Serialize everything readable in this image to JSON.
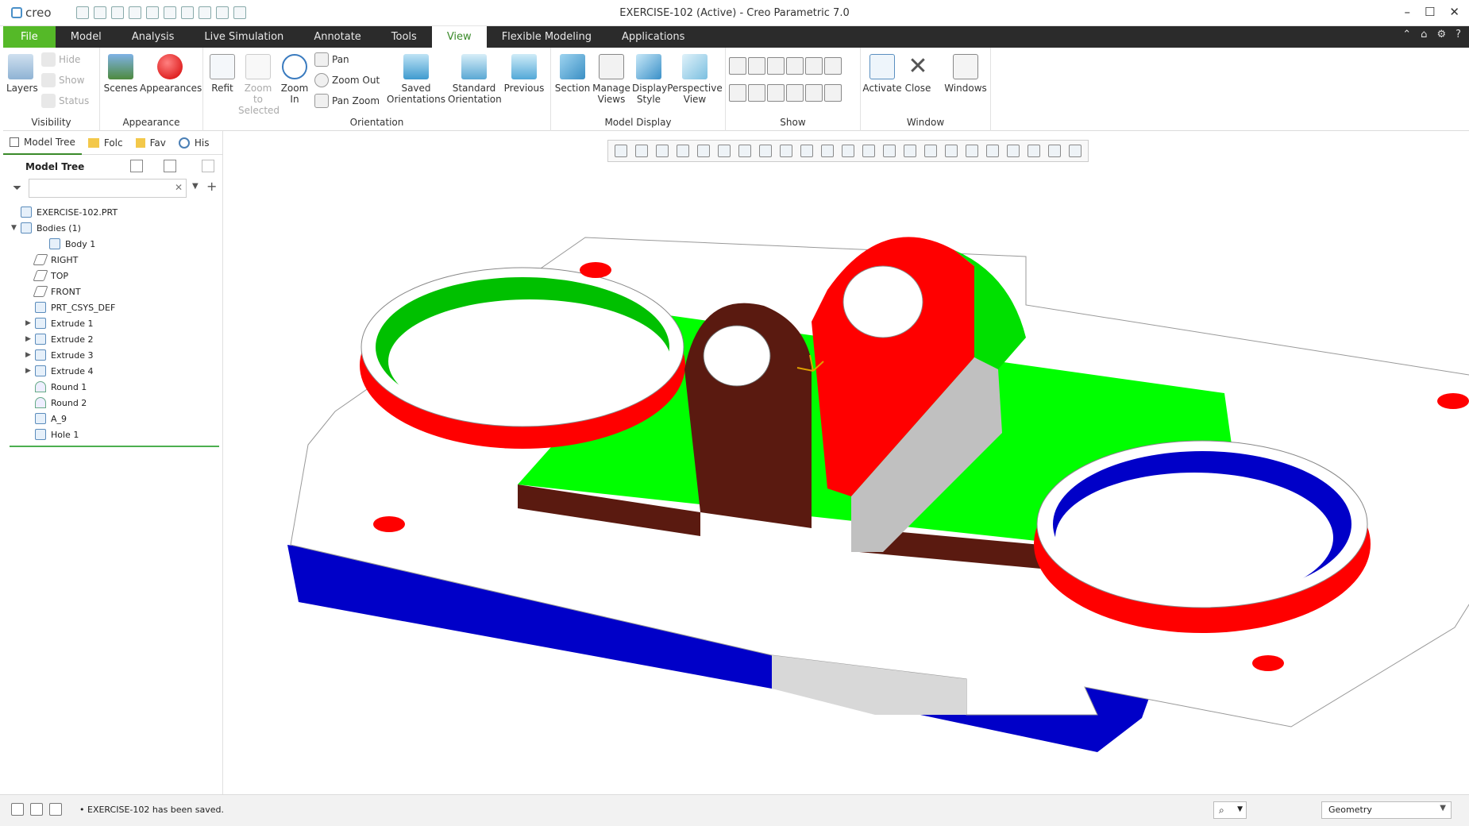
{
  "app": {
    "logo_text": "creo",
    "window_title": "EXERCISE-102 (Active) - Creo Parametric 7.0"
  },
  "ribbon_tabs": [
    "File",
    "Model",
    "Analysis",
    "Live Simulation",
    "Annotate",
    "Tools",
    "View",
    "Flexible Modeling",
    "Applications"
  ],
  "active_tab": "View",
  "ribbon": {
    "visibility": {
      "label": "Visibility",
      "layers": "Layers",
      "hide": "Hide",
      "show": "Show",
      "status": "Status"
    },
    "appearance": {
      "label": "Appearance",
      "scenes": "Scenes",
      "appearances": "Appearances"
    },
    "orientation": {
      "label": "Orientation",
      "refit": "Refit",
      "zoom_to_selected_1": "Zoom to",
      "zoom_to_selected_2": "Selected",
      "zoom_in_1": "Zoom",
      "zoom_in_2": "In",
      "pan": "Pan",
      "zoom_out": "Zoom Out",
      "pan_zoom": "Pan Zoom",
      "saved_1": "Saved",
      "saved_2": "Orientations",
      "standard_1": "Standard",
      "standard_2": "Orientation",
      "previous": "Previous"
    },
    "model_display": {
      "label": "Model Display",
      "section": "Section",
      "manage_1": "Manage",
      "manage_2": "Views",
      "display_1": "Display",
      "display_2": "Style",
      "perspective_1": "Perspective",
      "perspective_2": "View"
    },
    "show": {
      "label": "Show"
    },
    "window": {
      "label": "Window",
      "activate": "Activate",
      "close": "Close",
      "windows": "Windows"
    }
  },
  "panel": {
    "tabs": [
      "Model Tree",
      "Folc",
      "Fav",
      "His"
    ],
    "header": "Model Tree",
    "search_value": "",
    "tree": [
      {
        "label": "EXERCISE-102.PRT",
        "level": 0,
        "expander": "",
        "kind": "part"
      },
      {
        "label": "Bodies (1)",
        "level": 0,
        "expander": "▼",
        "kind": "body"
      },
      {
        "label": "Body 1",
        "level": 2,
        "expander": "",
        "kind": "body"
      },
      {
        "label": "RIGHT",
        "level": 1,
        "expander": "",
        "kind": "plane"
      },
      {
        "label": "TOP",
        "level": 1,
        "expander": "",
        "kind": "plane"
      },
      {
        "label": "FRONT",
        "level": 1,
        "expander": "",
        "kind": "plane"
      },
      {
        "label": "PRT_CSYS_DEF",
        "level": 1,
        "expander": "",
        "kind": "csys"
      },
      {
        "label": "Extrude 1",
        "level": 1,
        "expander": "▶",
        "kind": "feature"
      },
      {
        "label": "Extrude 2",
        "level": 1,
        "expander": "▶",
        "kind": "feature"
      },
      {
        "label": "Extrude 3",
        "level": 1,
        "expander": "▶",
        "kind": "feature"
      },
      {
        "label": "Extrude 4",
        "level": 1,
        "expander": "▶",
        "kind": "feature"
      },
      {
        "label": "Round 1",
        "level": 1,
        "expander": "",
        "kind": "round"
      },
      {
        "label": "Round 2",
        "level": 1,
        "expander": "",
        "kind": "round"
      },
      {
        "label": "A_9",
        "level": 1,
        "expander": "",
        "kind": "axis"
      },
      {
        "label": "Hole 1",
        "level": 1,
        "expander": "",
        "kind": "hole"
      }
    ]
  },
  "status": {
    "message": "EXERCISE-102 has been saved.",
    "filter_value": "Geometry"
  },
  "colors": {
    "file_tab": "#55b928",
    "tab_bar": "#2b2b2b",
    "model_green": "#00ff00",
    "model_red": "#ff0000",
    "model_blue": "#0000c8",
    "model_brown": "#5a1a10"
  }
}
